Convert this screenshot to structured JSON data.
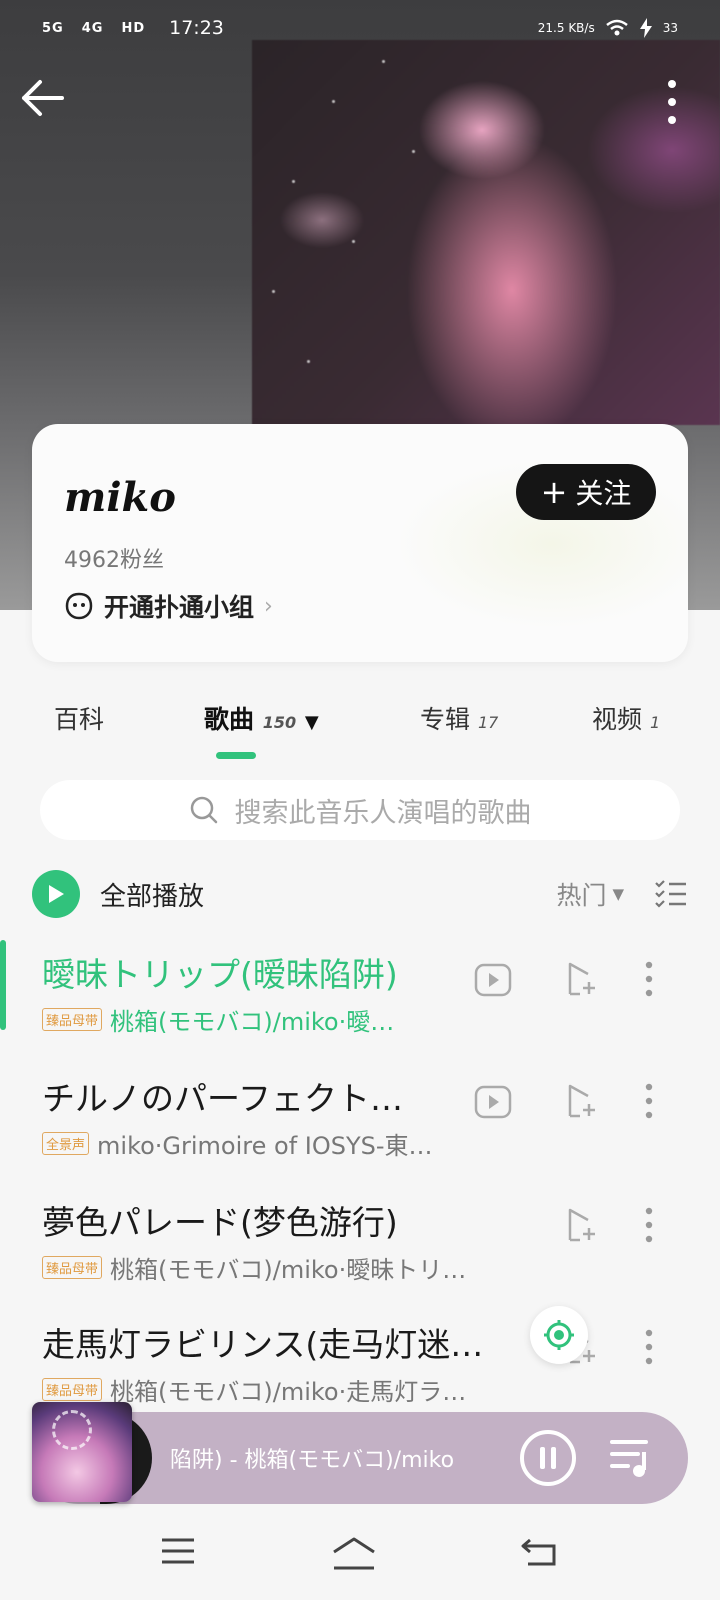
{
  "status_bar": {
    "signal_1": "5G",
    "signal_2": "4G",
    "hd": "HD",
    "time": "17:23",
    "net_speed": "21.5 KB/s",
    "battery": "33"
  },
  "artist": {
    "name": "miko",
    "fans": "4962粉丝",
    "group_link": "开通扑通小组",
    "follow_label": "关注"
  },
  "tabs": [
    {
      "label": "百科",
      "count": ""
    },
    {
      "label": "歌曲",
      "count": "150"
    },
    {
      "label": "专辑",
      "count": "17"
    },
    {
      "label": "视频",
      "count": "1"
    }
  ],
  "search": {
    "placeholder": "搜索此音乐人演唱的歌曲"
  },
  "play_all": {
    "label": "全部播放",
    "sort_label": "热门"
  },
  "songs": [
    {
      "title": "曖昧トリップ(暧昧陷阱)",
      "badge": "臻品母带",
      "subtitle": "桃箱(モモバコ)/miko·曖…"
    },
    {
      "title": "チルノのパーフェクト…",
      "badge": "全景声",
      "subtitle": "miko·Grimoire of IOSYS-東…"
    },
    {
      "title": "夢色パレード(梦色游行)",
      "badge": "臻品母带",
      "subtitle": "桃箱(モモバコ)/miko·曖昧トリ…"
    },
    {
      "title": "走馬灯ラビリンス(走马灯迷…",
      "badge": "臻品母带",
      "subtitle": "桃箱(モモバコ)/miko·走馬灯ラ…"
    }
  ],
  "player": {
    "now_playing": "陷阱) - 桃箱(モモバコ)/miko"
  },
  "colors": {
    "accent": "#31c27c",
    "badge": "#e09a40",
    "player_bg": "#c3b1c5"
  }
}
